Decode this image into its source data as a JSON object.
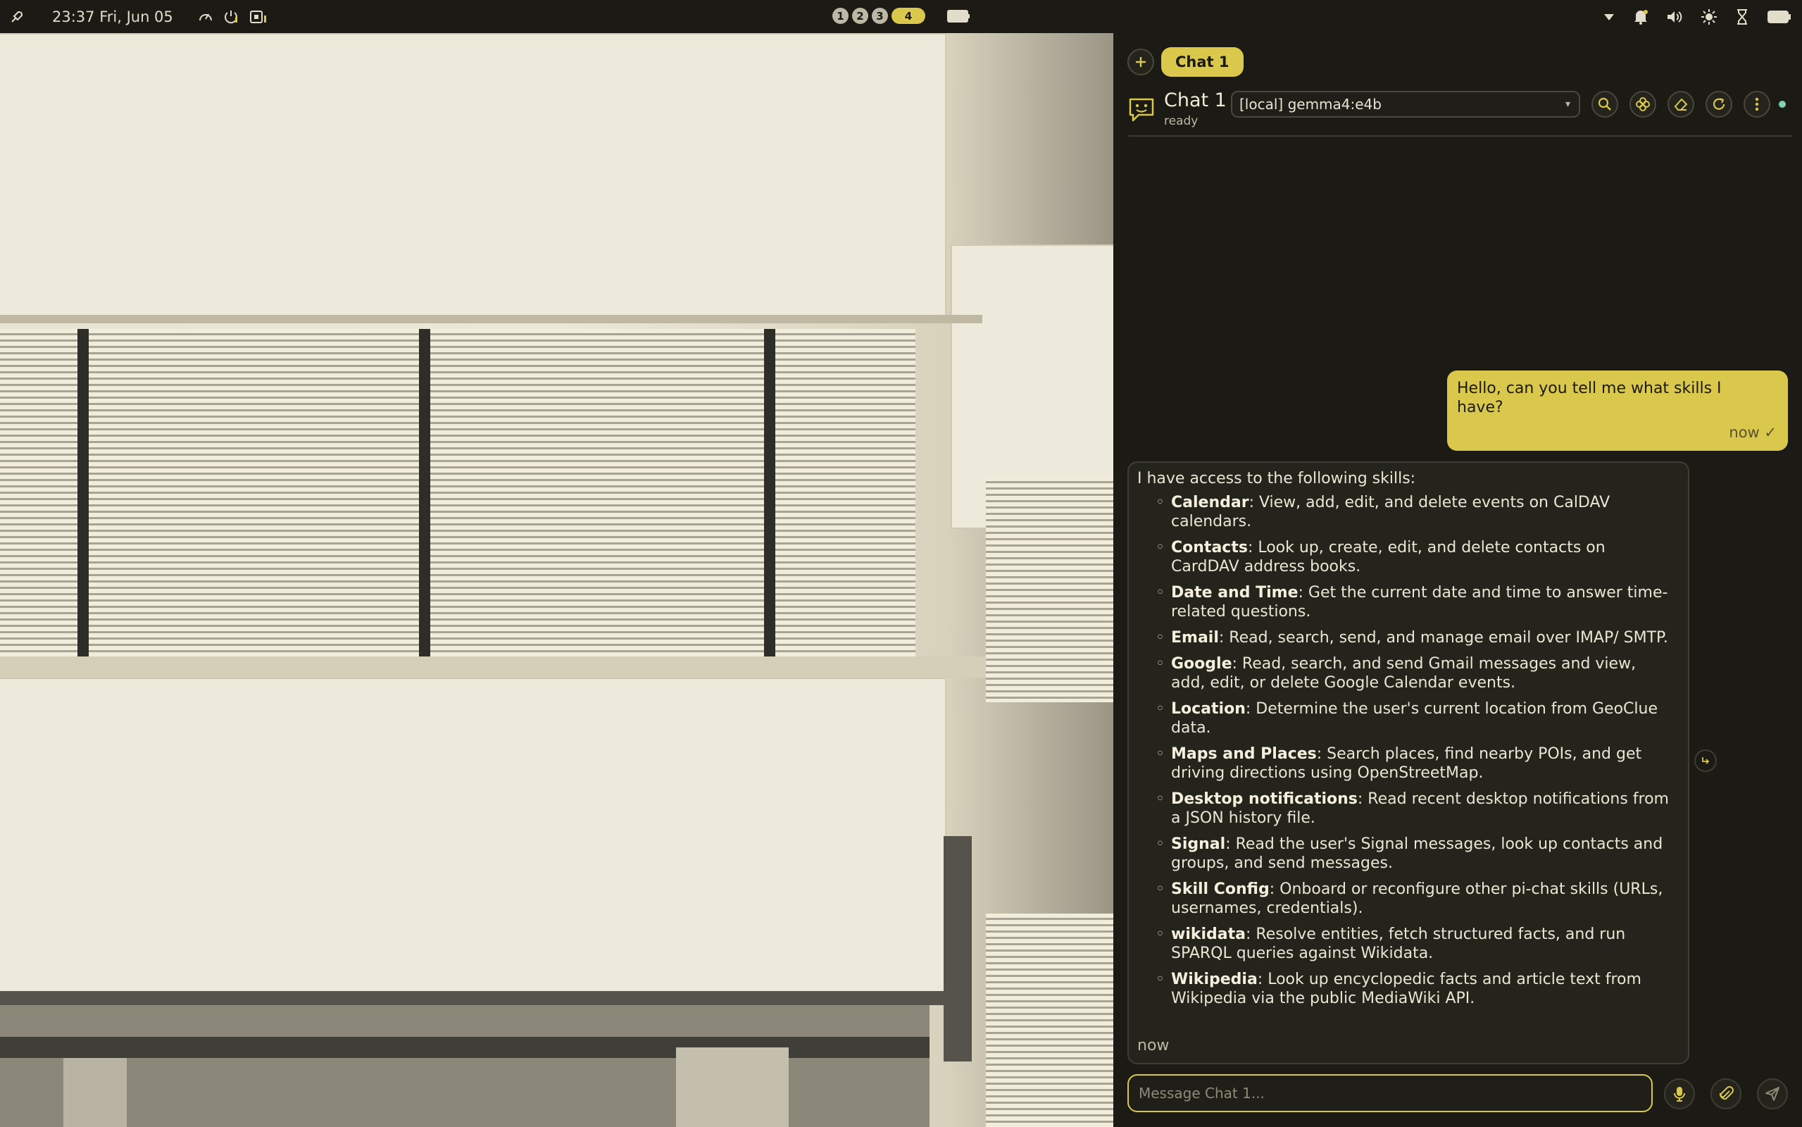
{
  "topbar": {
    "launcher_icon": "rocket-icon",
    "clock": "23:37 Fri, Jun 05",
    "system_icons": [
      "gauge-icon",
      "power-icon",
      "cpu-icon"
    ],
    "workspaces": [
      "1",
      "2",
      "3"
    ],
    "active_workspace": "4",
    "right_icons": [
      "chevron-down-icon",
      "bell-icon",
      "volume-icon",
      "brightness-icon",
      "hourglass-icon",
      "battery-icon"
    ]
  },
  "chat": {
    "tab_active": "Chat 1",
    "title": "Chat 1",
    "status": "ready",
    "model": "[local] gemma4:e4b",
    "colors": {
      "accent": "#d9c84b",
      "background": "#1b1a14",
      "online": "#7fd3b0"
    }
  },
  "messages": {
    "user": {
      "text": "Hello, can you tell me what skills I have?",
      "time": "now ✓"
    },
    "assistant": {
      "intro": "I have access to the following skills:",
      "time": "now",
      "skills": [
        {
          "name": "Calendar",
          "desc": ": View, add, edit, and delete events on CalDAV calendars."
        },
        {
          "name": "Contacts",
          "desc": ": Look up, create, edit, and delete contacts on CardDAV address books."
        },
        {
          "name": "Date and Time",
          "desc": ": Get the current date and time to answer time-related questions."
        },
        {
          "name": "Email",
          "desc": ": Read, search, send, and manage email over IMAP/ SMTP."
        },
        {
          "name": "Google",
          "desc": ": Read, search, and send Gmail messages and view, add, edit, or delete Google Calendar events."
        },
        {
          "name": "Location",
          "desc": ": Determine the user's current location from GeoClue data."
        },
        {
          "name": "Maps and Places",
          "desc": ": Search places, find nearby POIs, and get driving directions using OpenStreetMap."
        },
        {
          "name": "Desktop notifications",
          "desc": ": Read recent desktop notifications from a JSON history file."
        },
        {
          "name": "Signal",
          "desc": ": Read the user's Signal messages, look up contacts and groups, and send messages."
        },
        {
          "name": "Skill Config",
          "desc": ": Onboard or reconfigure other pi-chat skills (URLs, usernames, credentials)."
        },
        {
          "name": "wikidata",
          "desc": ": Resolve entities, fetch structured facts, and run SPARQL queries against Wikidata."
        },
        {
          "name": "Wikipedia",
          "desc": ": Look up encyclopedic facts and article text from Wikipedia via the public MediaWiki API."
        }
      ]
    }
  },
  "composer": {
    "placeholder": "Message Chat 1..."
  }
}
